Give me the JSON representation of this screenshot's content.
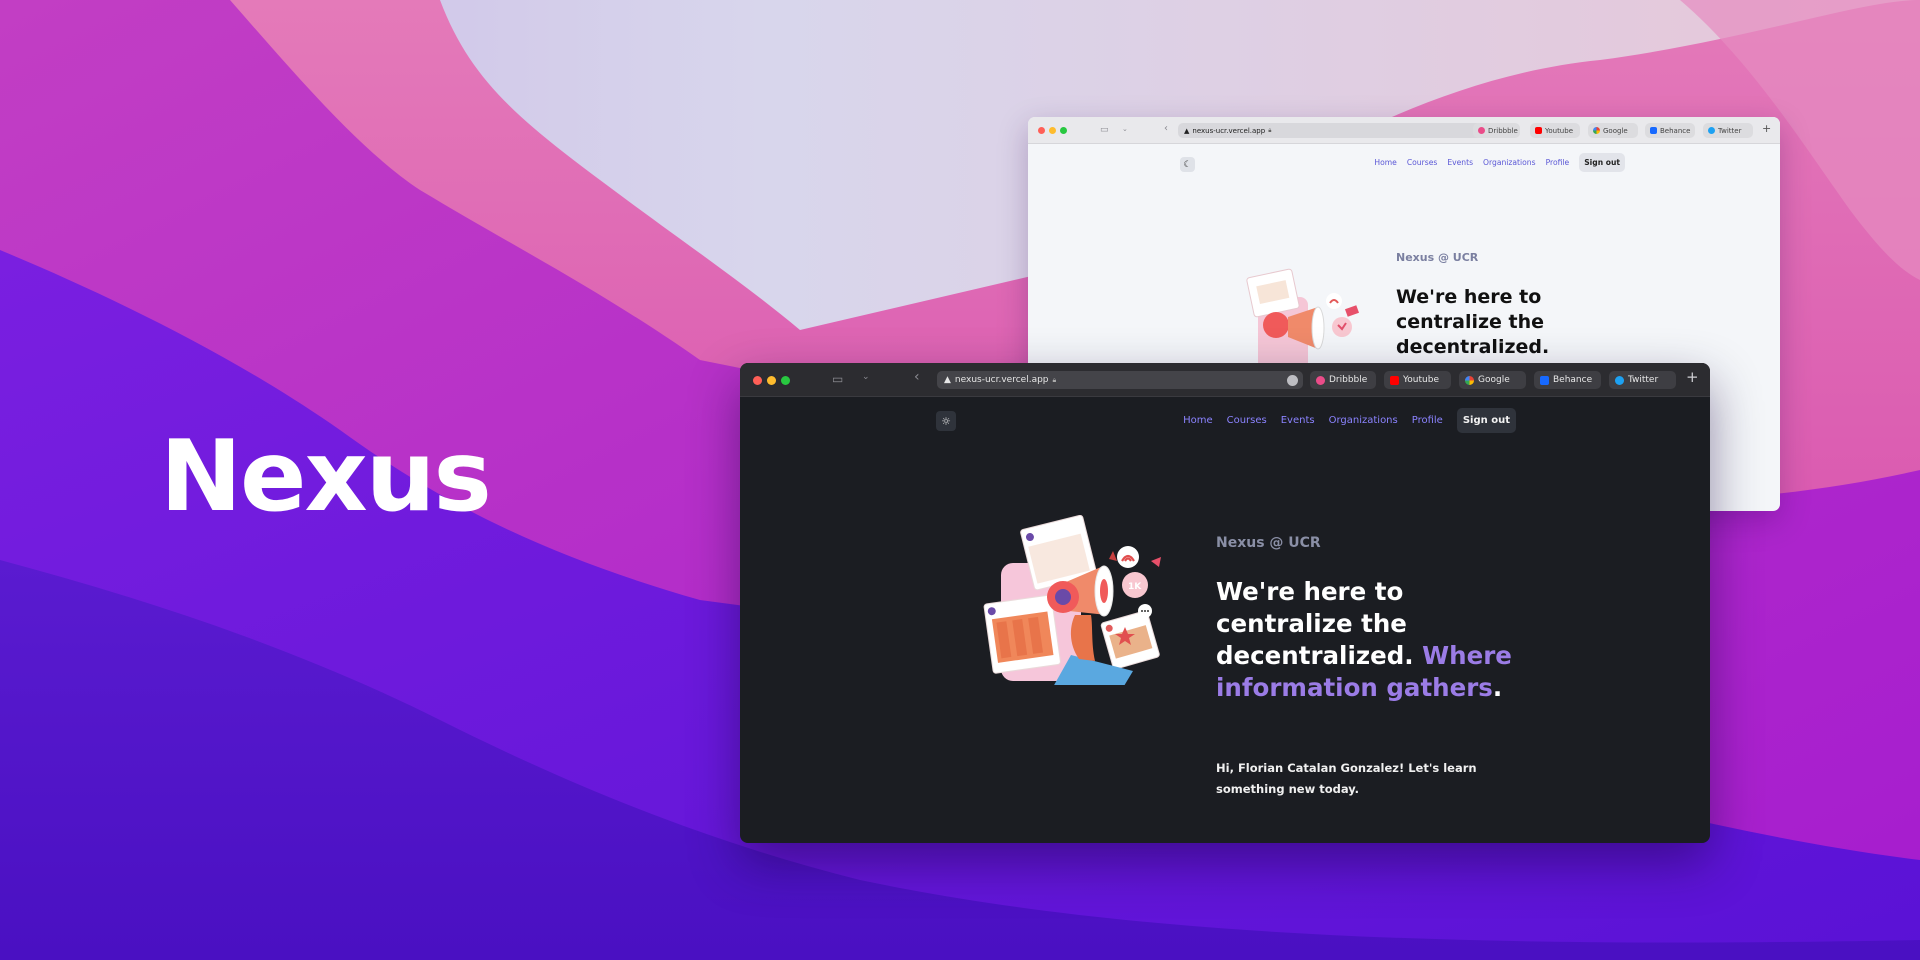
{
  "hero": {
    "title": "Nexus"
  },
  "colors": {
    "wallpaper_top": "#d6d3ea",
    "wallpaper_pink": "#d43ca8",
    "wallpaper_purple": "#5a12d6",
    "accent": "#9b7ce6",
    "link": "#8b83ff"
  },
  "light_window": {
    "url": "nexus-ucr.vercel.app",
    "tabs": [
      {
        "label": "Dribbble",
        "icon": "dribbble-icon"
      },
      {
        "label": "Youtube",
        "icon": "youtube-icon"
      },
      {
        "label": "Google",
        "icon": "google-icon"
      },
      {
        "label": "Behance",
        "icon": "behance-icon"
      },
      {
        "label": "Twitter",
        "icon": "twitter-icon"
      }
    ],
    "nav": [
      "Home",
      "Courses",
      "Events",
      "Organizations",
      "Profile"
    ],
    "sign_out": "Sign out",
    "theme_icon": "moon-icon",
    "eyebrow": "Nexus @ UCR",
    "heading": "We're here to centralize the decentralized."
  },
  "dark_window": {
    "url": "nexus-ucr.vercel.app",
    "tabs": [
      {
        "label": "Dribbble",
        "icon": "dribbble-icon"
      },
      {
        "label": "Youtube",
        "icon": "youtube-icon"
      },
      {
        "label": "Google",
        "icon": "google-icon"
      },
      {
        "label": "Behance",
        "icon": "behance-icon"
      },
      {
        "label": "Twitter",
        "icon": "twitter-icon"
      }
    ],
    "nav": [
      "Home",
      "Courses",
      "Events",
      "Organizations",
      "Profile"
    ],
    "sign_out": "Sign out",
    "theme_icon": "sun-icon",
    "eyebrow": "Nexus @ UCR",
    "heading_plain": "We're here to centralize the decentralized.",
    "heading_accent": "Where information gathers",
    "heading_end": ".",
    "greeting": "Hi, Florian Catalan Gonzalez! Let's learn something new today."
  }
}
